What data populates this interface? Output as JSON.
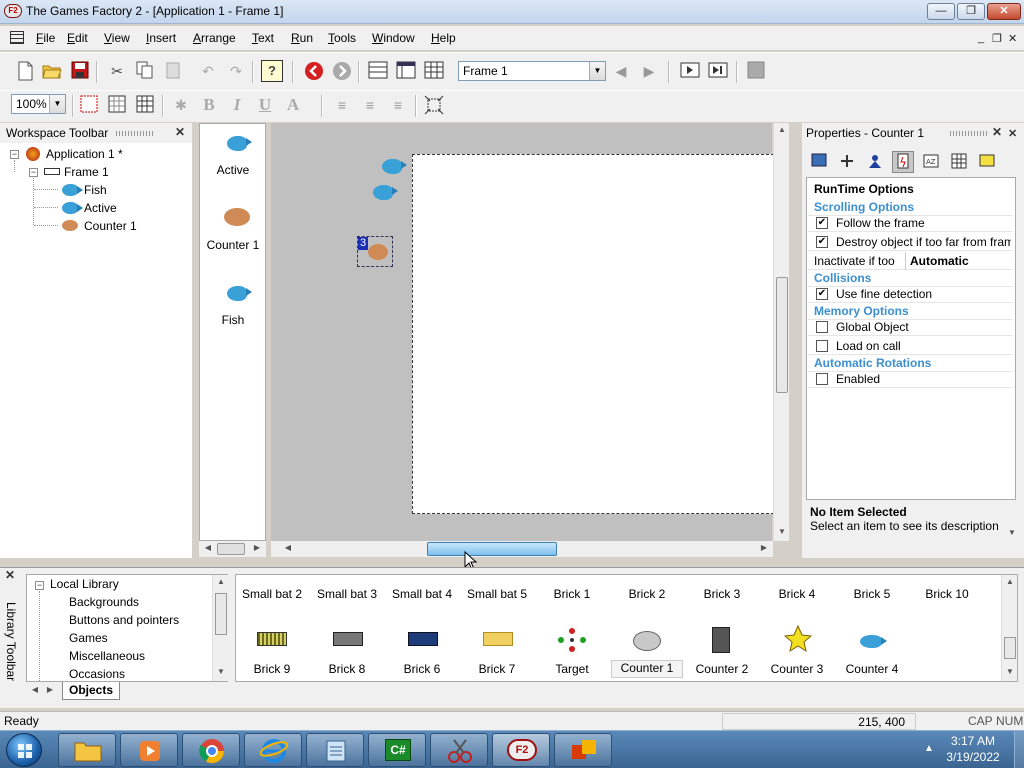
{
  "window": {
    "title": "The Games Factory 2 - [Application 1 - Frame 1]",
    "app_icon_text": "F2",
    "minimize": "—",
    "maximize": "❐",
    "close": "✕"
  },
  "menu": {
    "items": [
      {
        "label": "File",
        "u": "F",
        "rest": "ile"
      },
      {
        "label": "Edit",
        "u": "E",
        "rest": "dit"
      },
      {
        "label": "View",
        "u": "V",
        "rest": "iew"
      },
      {
        "label": "Insert",
        "u": "I",
        "rest": "nsert"
      },
      {
        "label": "Arrange",
        "u": "A",
        "rest": "rrange"
      },
      {
        "label": "Text",
        "u": "T",
        "rest": "ext"
      },
      {
        "label": "Run",
        "u": "R",
        "rest": "un"
      },
      {
        "label": "Tools",
        "u": "T",
        "rest": "ools"
      },
      {
        "label": "Window",
        "u": "W",
        "rest": "indow"
      },
      {
        "label": "Help",
        "u": "H",
        "rest": "elp"
      }
    ],
    "mdi_minimize": "_",
    "mdi_restore": "❐",
    "mdi_close": "✕"
  },
  "toolbar": {
    "frame_combo": "Frame 1",
    "zoom_combo": "100%",
    "bold": "B",
    "italic": "I",
    "underline": "U",
    "font_color": "A",
    "help_icon": "?"
  },
  "workspace": {
    "title": "Workspace Toolbar",
    "close": "✕",
    "tree": {
      "application": "Application 1 *",
      "frame": "Frame 1",
      "objects": [
        "Fish",
        "Active",
        "Counter 1"
      ]
    }
  },
  "objects_list": {
    "items": [
      "Active",
      "Counter 1",
      "Fish"
    ]
  },
  "frame_editor": {
    "counter_value": "3"
  },
  "properties": {
    "title": "Properties - Counter 1",
    "close": "✕",
    "header": "RunTime Options",
    "rows": [
      {
        "type": "category",
        "label": "Scrolling Options"
      },
      {
        "type": "check",
        "label": "Follow the frame",
        "checked": true
      },
      {
        "type": "check",
        "label": "Destroy object if too far from frame",
        "checked": true
      },
      {
        "type": "value",
        "label": "Inactivate if too",
        "value": "Automatic"
      },
      {
        "type": "category",
        "label": "Collisions"
      },
      {
        "type": "check",
        "label": "Use fine detection",
        "checked": true
      },
      {
        "type": "category",
        "label": "Memory Options"
      },
      {
        "type": "check",
        "label": "Global Object",
        "checked": false
      },
      {
        "type": "check",
        "label": "Load on call",
        "checked": false
      },
      {
        "type": "category",
        "label": "Automatic Rotations"
      },
      {
        "type": "check",
        "label": "Enabled",
        "checked": false
      }
    ],
    "description_title": "No Item Selected",
    "description_text": "Select an item to see its description"
  },
  "library": {
    "side_title": "Library Toolbar",
    "close": "✕",
    "tree": [
      "Local Library",
      "Backgrounds",
      "Buttons and pointers",
      "Games",
      "Miscellaneous",
      "Occasions"
    ],
    "tab": "Objects",
    "row1": [
      "Small bat 2",
      "Small bat 3",
      "Small bat 4",
      "Small bat 5",
      "Brick 1",
      "Brick 2",
      "Brick 3",
      "Brick 4",
      "Brick 5",
      "Brick 10"
    ],
    "row2": [
      "Brick 9",
      "Brick 8",
      "Brick 6",
      "Brick 7",
      "Target",
      "Counter 1",
      "Counter 2",
      "Counter 3",
      "Counter 4"
    ]
  },
  "status": {
    "text": "Ready",
    "coords": "215, 400",
    "cap": "CAP",
    "num": "NUM"
  },
  "taskbar": {
    "time": "3:17 AM",
    "date": "3/19/2022",
    "csharp_label": "C#",
    "tgf_label": "F2"
  }
}
